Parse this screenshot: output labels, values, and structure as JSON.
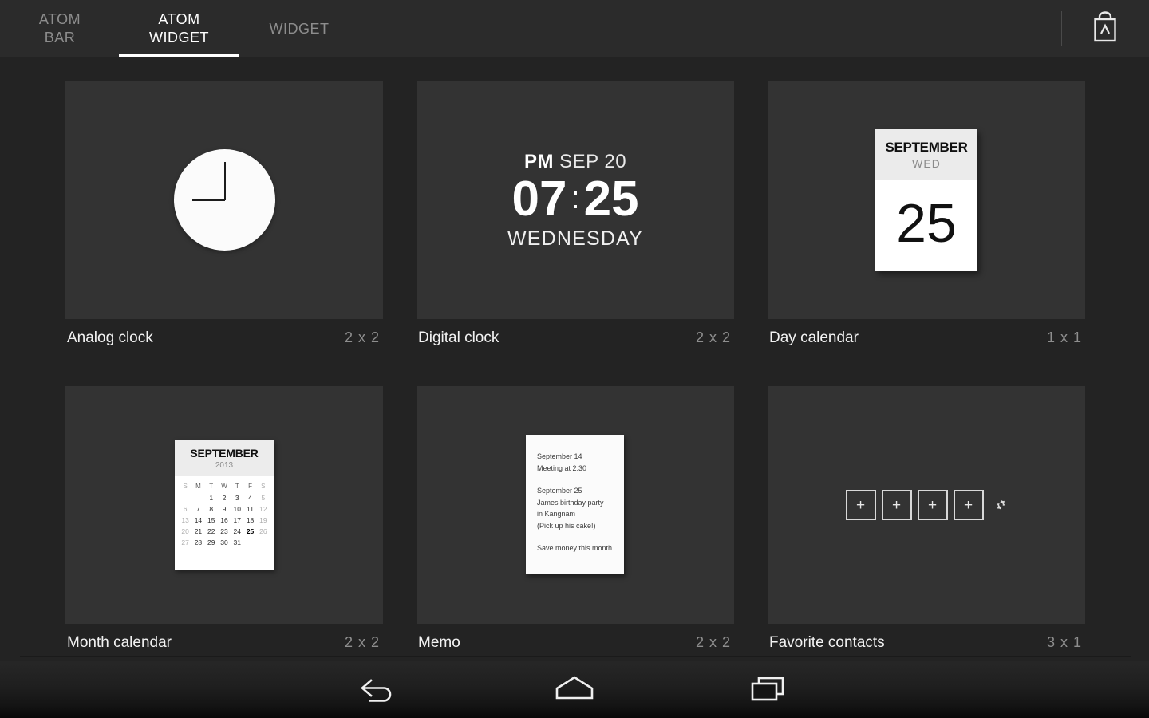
{
  "header": {
    "tabs": [
      {
        "line1": "ATOM",
        "line2": "BAR",
        "active": false,
        "name": "tab-atom-bar"
      },
      {
        "line1": "ATOM",
        "line2": "WIDGET",
        "active": true,
        "name": "tab-atom-widget"
      },
      {
        "line1": "WIDGET",
        "line2": "",
        "active": false,
        "name": "tab-widget"
      }
    ],
    "store_icon": "shopping-bag-icon",
    "store_icon_letter": "A"
  },
  "widgets": [
    {
      "title": "Analog clock",
      "size": "2 x 2"
    },
    {
      "title": "Digital clock",
      "size": "2 x 2"
    },
    {
      "title": "Day calendar",
      "size": "1 x 1"
    },
    {
      "title": "Month calendar",
      "size": "2 x 2"
    },
    {
      "title": "Memo",
      "size": "2 x 2"
    },
    {
      "title": "Favorite contacts",
      "size": "3 x 1"
    }
  ],
  "analog_clock": {
    "hour_hand_direction": "9",
    "minute_hand_direction": "12"
  },
  "digital_clock": {
    "ampm": "PM",
    "date": "SEP 20",
    "hours": "07",
    "colon": ":",
    "minutes": "25",
    "weekday": "WEDNESDAY"
  },
  "day_calendar": {
    "month": "SEPTEMBER",
    "weekday": "WED",
    "day": "25"
  },
  "month_calendar": {
    "month": "SEPTEMBER",
    "year": "2013",
    "dow": [
      "S",
      "M",
      "T",
      "W",
      "T",
      "F",
      "S"
    ],
    "weeks": [
      [
        "",
        "",
        "1",
        "2",
        "3",
        "4",
        "5"
      ],
      [
        "6",
        "7",
        "8",
        "9",
        "10",
        "11",
        "12"
      ],
      [
        "13",
        "14",
        "15",
        "16",
        "17",
        "18",
        "19"
      ],
      [
        "20",
        "21",
        "22",
        "23",
        "24",
        "25",
        "26"
      ],
      [
        "27",
        "28",
        "29",
        "30",
        "31",
        "",
        ""
      ]
    ],
    "today": "25"
  },
  "memo": {
    "lines": [
      "September 14",
      "Meeting at 2:30",
      "",
      "September 25",
      "James birthday party",
      "in Kangnam",
      "(Pick up his cake!)",
      "",
      "Save money this month"
    ]
  },
  "favorite_contacts": {
    "slots": [
      "+",
      "+",
      "+",
      "+"
    ],
    "settings_icon": "gear-icon"
  },
  "navbar": {
    "buttons": [
      {
        "name": "nav-back-button",
        "icon": "back-arrow-icon"
      },
      {
        "name": "nav-home-button",
        "icon": "home-icon"
      },
      {
        "name": "nav-recents-button",
        "icon": "recents-icon"
      }
    ]
  },
  "colors": {
    "page_bg": "#232323",
    "tile_bg": "#333333",
    "topbar_bg": "#2b2b2b",
    "accent": "#ffffff",
    "label": "#f2f2f2",
    "muted": "#8e8e8e"
  }
}
